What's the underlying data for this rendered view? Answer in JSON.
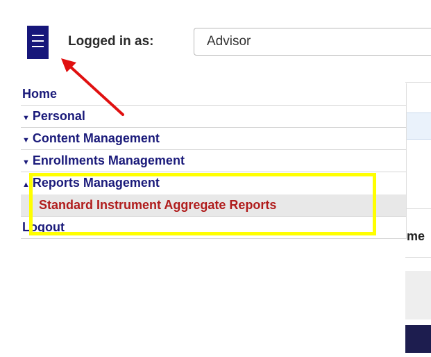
{
  "header": {
    "logged_in_label": "Logged in as:",
    "role_value": "Advisor"
  },
  "menu": {
    "home": "Home",
    "personal": "Personal",
    "content_management": "Content Management",
    "enrollments_management": "Enrollments Management",
    "reports_management": "Reports Management",
    "reports_sub_item": "Standard Instrument Aggregate Reports",
    "logout": "Logout",
    "caret_collapsed": "▼",
    "caret_expanded": "▲"
  },
  "background": {
    "partial_header_text": "me"
  },
  "annotations": {
    "arrow_color": "#e01010",
    "highlight_color": "#ffff00"
  }
}
